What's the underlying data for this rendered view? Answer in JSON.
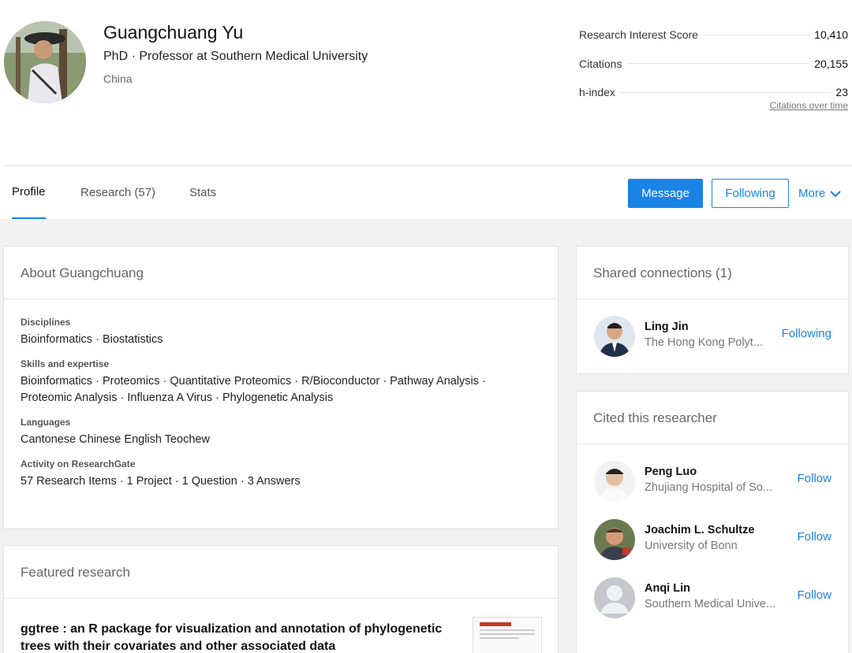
{
  "profile": {
    "name": "Guangchuang Yu",
    "title": "PhD · Professor at Southern Medical University",
    "country": "China"
  },
  "stats": {
    "items": [
      {
        "label": "Research Interest Score",
        "value": "10,410"
      },
      {
        "label": "Citations",
        "value": "20,155"
      },
      {
        "label": "h-index",
        "value": "23"
      }
    ],
    "citations_link": "Citations over time"
  },
  "nav": {
    "tabs": [
      {
        "label": "Profile"
      },
      {
        "label": "Research (57)"
      },
      {
        "label": "Stats"
      }
    ],
    "message_label": "Message",
    "following_label": "Following",
    "more_label": "More"
  },
  "about": {
    "heading": "About Guangchuang",
    "sections": [
      {
        "label": "Disciplines",
        "value": "Bioinformatics · Biostatistics"
      },
      {
        "label": "Skills and expertise",
        "value": "Bioinformatics · Proteomics · Quantitative Proteomics · R/Bioconductor · Pathway Analysis · Proteomic Analysis · Influenza A Virus · Phylogenetic Analysis"
      },
      {
        "label": "Languages",
        "value": "Cantonese Chinese English Teochew"
      },
      {
        "label": "Activity on ResearchGate",
        "value": "57 Research Items · 1 Project · 1 Question · 3 Answers"
      }
    ]
  },
  "featured": {
    "heading": "Featured research",
    "title": "ggtree : an R package for visualization and annotation of phylogenetic trees with their covariates and other associated data"
  },
  "shared": {
    "heading": "Shared connections (1)",
    "people": [
      {
        "name": "Ling Jin",
        "affiliation": "The Hong Kong Polyt...",
        "action": "Following"
      }
    ]
  },
  "cited": {
    "heading": "Cited this researcher",
    "people": [
      {
        "name": "Peng Luo",
        "affiliation": "Zhujiang Hospital of So...",
        "action": "Follow"
      },
      {
        "name": "Joachim L. Schultze",
        "affiliation": "University of Bonn",
        "action": "Follow"
      },
      {
        "name": "Anqi Lin",
        "affiliation": "Southern Medical Unive...",
        "action": "Follow"
      }
    ]
  },
  "colors": {
    "accent": "#1a83e6",
    "page_bg": "#f2f2f2"
  }
}
